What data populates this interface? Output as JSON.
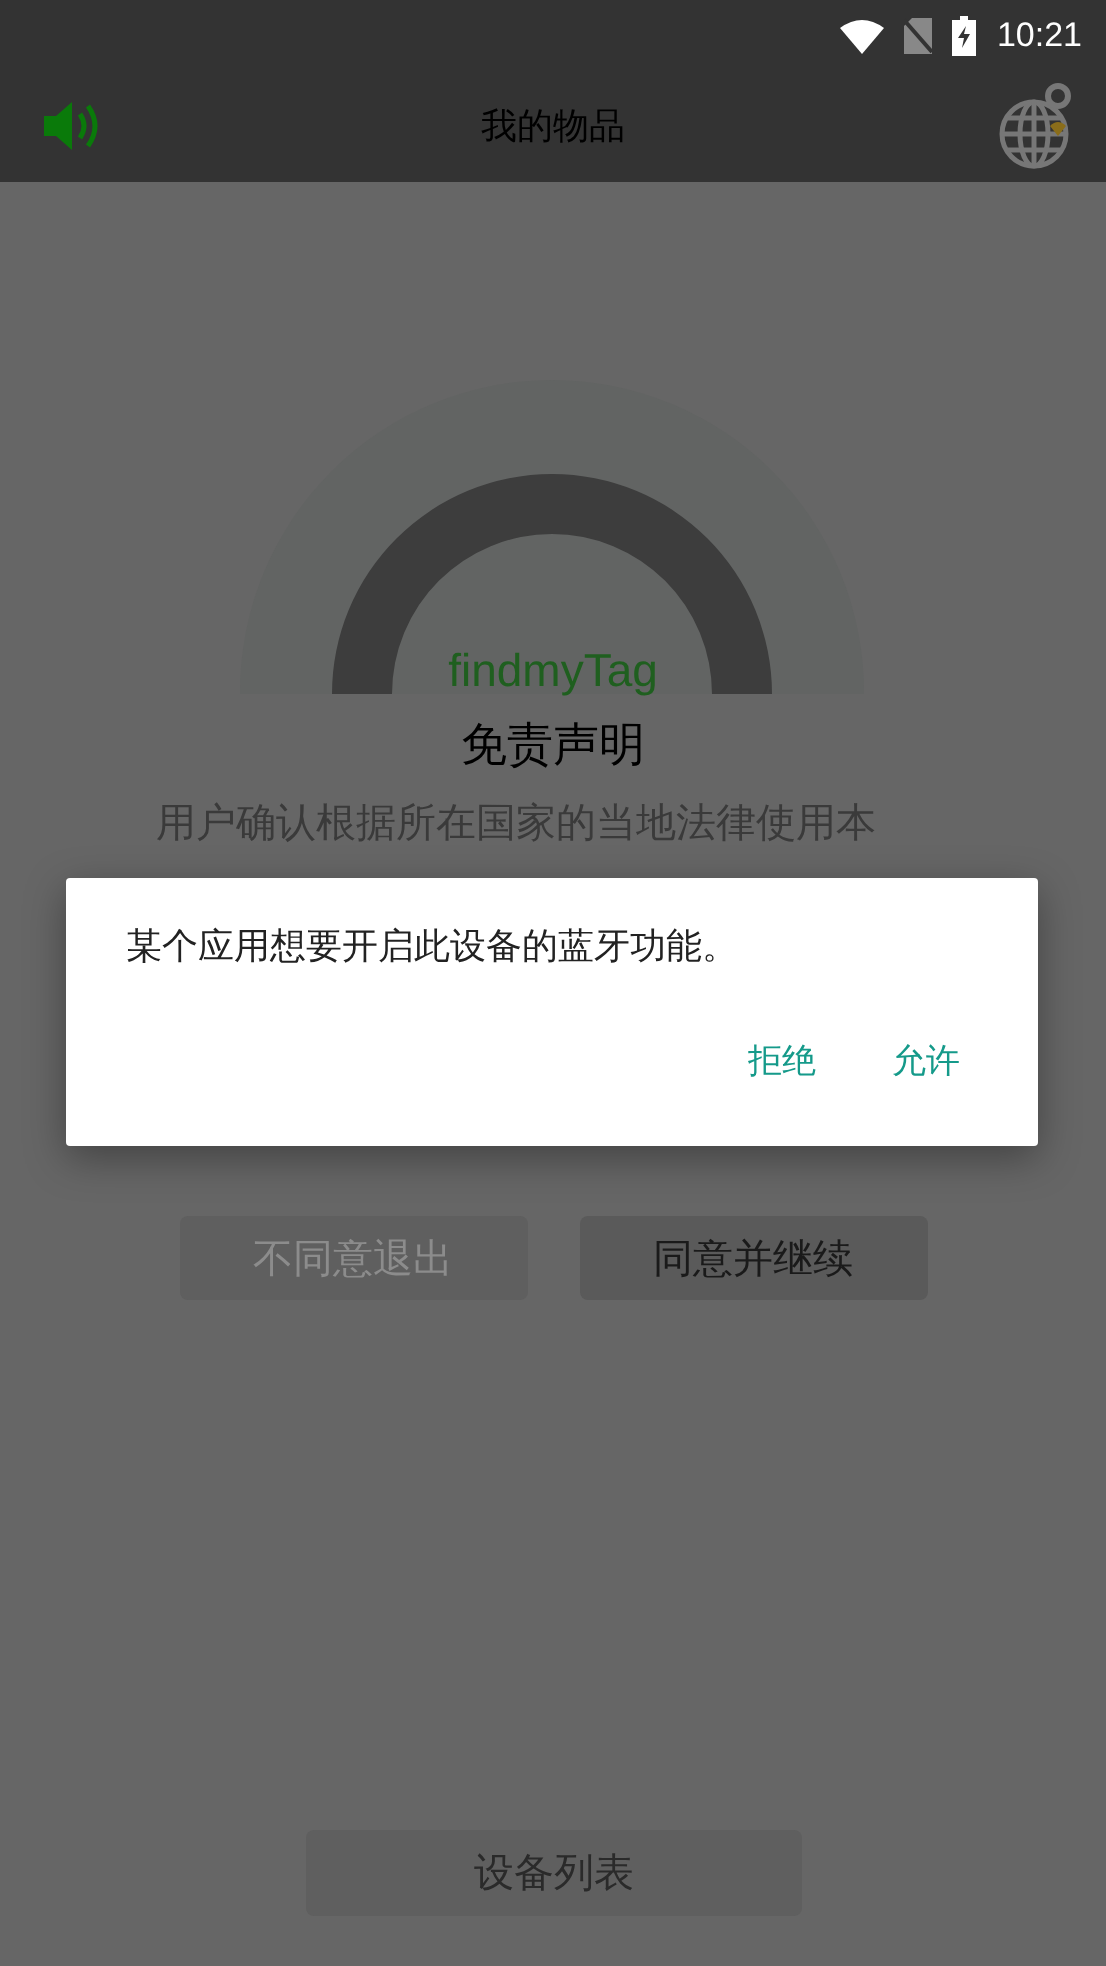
{
  "status_bar": {
    "time": "10:21"
  },
  "toolbar": {
    "title": "我的物品"
  },
  "logo": {
    "text": "findmyTag"
  },
  "disclaimer": {
    "title": "免责声明",
    "lines": [
      "用户确认根据所在国家的当地法律使用本"
    ]
  },
  "buttons": [
    {
      "label": "不同意退出",
      "disabled": true
    },
    {
      "label": "同意并继续",
      "disabled": false
    }
  ],
  "bottom_button": {
    "label": "设备列表"
  },
  "dialog": {
    "message": "某个应用想要开启此设备的蓝牙功能。",
    "actions": [
      "拒绝",
      "允许"
    ]
  }
}
